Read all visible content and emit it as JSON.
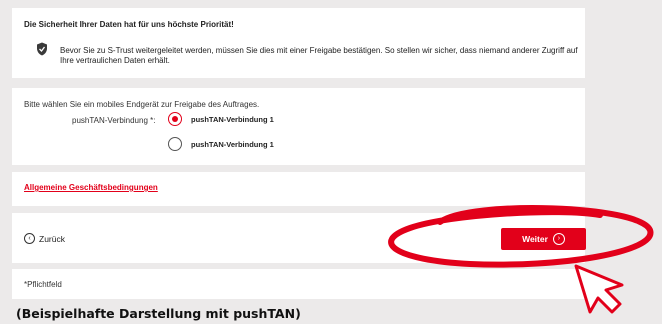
{
  "security": {
    "heading": "Die Sicherheit Ihrer Daten hat für uns höchste Priorität!",
    "info": "Bevor Sie zu S-Trust weitergeleitet werden, müssen Sie dies mit einer Freigabe bestätigen. So stellen wir sicher, dass niemand anderer Zugriff auf Ihre vertraulichen Daten erhält.",
    "icon": "shield-check-icon"
  },
  "device": {
    "prompt": "Bitte wählen Sie ein mobiles Endgerät zur Freigabe des Auftrages.",
    "field_label": "pushTAN-Verbindung *:",
    "options": [
      {
        "label": "pushTAN-Verbindung 1",
        "selected": true
      },
      {
        "label": "pushTAN-Verbindung 1",
        "selected": false
      }
    ]
  },
  "links": {
    "agb": "Allgemeine Geschäftsbedingungen"
  },
  "nav": {
    "back_icon": "‹",
    "back_label": "Zurück",
    "next_label": "Weiter",
    "next_icon": "›"
  },
  "footer": {
    "required_note": "*Pflichtfeld"
  },
  "caption": "(Beispielhafte Darstellung mit pushTAN)",
  "colors": {
    "accent": "#e2001a",
    "background": "#eceaea"
  }
}
